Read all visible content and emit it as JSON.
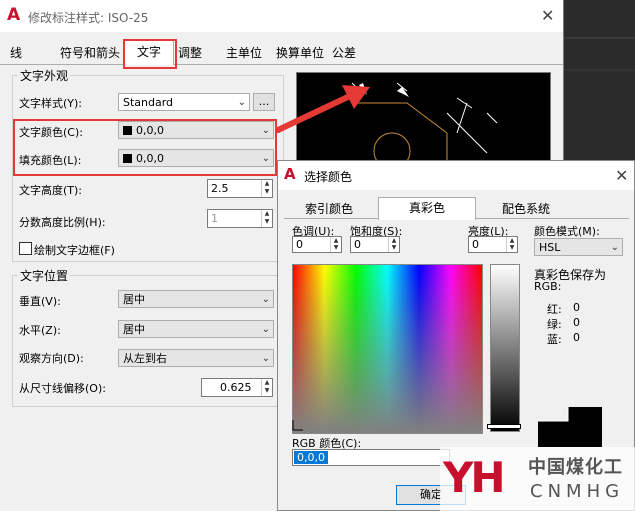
{
  "dim_dialog": {
    "title": "修改标注样式: ISO-25",
    "close": "✕",
    "tabs": [
      "线",
      "符号和箭头",
      "文字",
      "调整",
      "主单位",
      "换算单位",
      "公差"
    ],
    "active_tab": "文字",
    "text_appearance": {
      "group_title": "文字外观",
      "text_style_label": "文字样式(Y):",
      "text_style_value": "Standard",
      "browse_button": "...",
      "text_color_label": "文字颜色(C):",
      "text_color_value": "0,0,0",
      "fill_color_label": "填充颜色(L):",
      "fill_color_value": "0,0,0",
      "text_height_label": "文字高度(T):",
      "text_height_value": "2.5",
      "fraction_scale_label": "分数高度比例(H):",
      "fraction_scale_value": "1",
      "draw_frame_label": "绘制文字边框(F)"
    },
    "text_placement": {
      "group_title": "文字位置",
      "vertical_label": "垂直(V):",
      "vertical_value": "居中",
      "horizontal_label": "水平(Z):",
      "horizontal_value": "居中",
      "view_direction_label": "观察方向(D):",
      "view_direction_value": "从左到右",
      "offset_label": "从尺寸线偏移(O):",
      "offset_value": "0.625"
    }
  },
  "color_dialog": {
    "title": "选择颜色",
    "close": "✕",
    "tabs": [
      "索引颜色",
      "真彩色",
      "配色系统"
    ],
    "active_tab": "真彩色",
    "hue_label": "色调(U):",
    "hue_value": "0",
    "saturation_label": "饱和度(S):",
    "saturation_value": "0",
    "luminance_label": "亮度(L):",
    "luminance_value": "0",
    "color_model_label": "颜色模式(M):",
    "color_model_value": "HSL",
    "truecolor_saved_label": "真彩色保存为",
    "rgb_label": "RGB:",
    "red_label": "红:",
    "red_value": "0",
    "green_label": "绿:",
    "green_value": "0",
    "blue_label": "蓝:",
    "blue_value": "0",
    "rgb_color_label": "RGB 颜色(C):",
    "rgb_color_value": "0,0,0",
    "ok_button": "确定"
  },
  "watermark": {
    "chinese": "中国煤化工",
    "latin": "CNMHG",
    "mark": "YH"
  },
  "colors": {
    "highlight": "#e53935",
    "brand_red": "#c8102e",
    "selection": "#0078d7"
  }
}
